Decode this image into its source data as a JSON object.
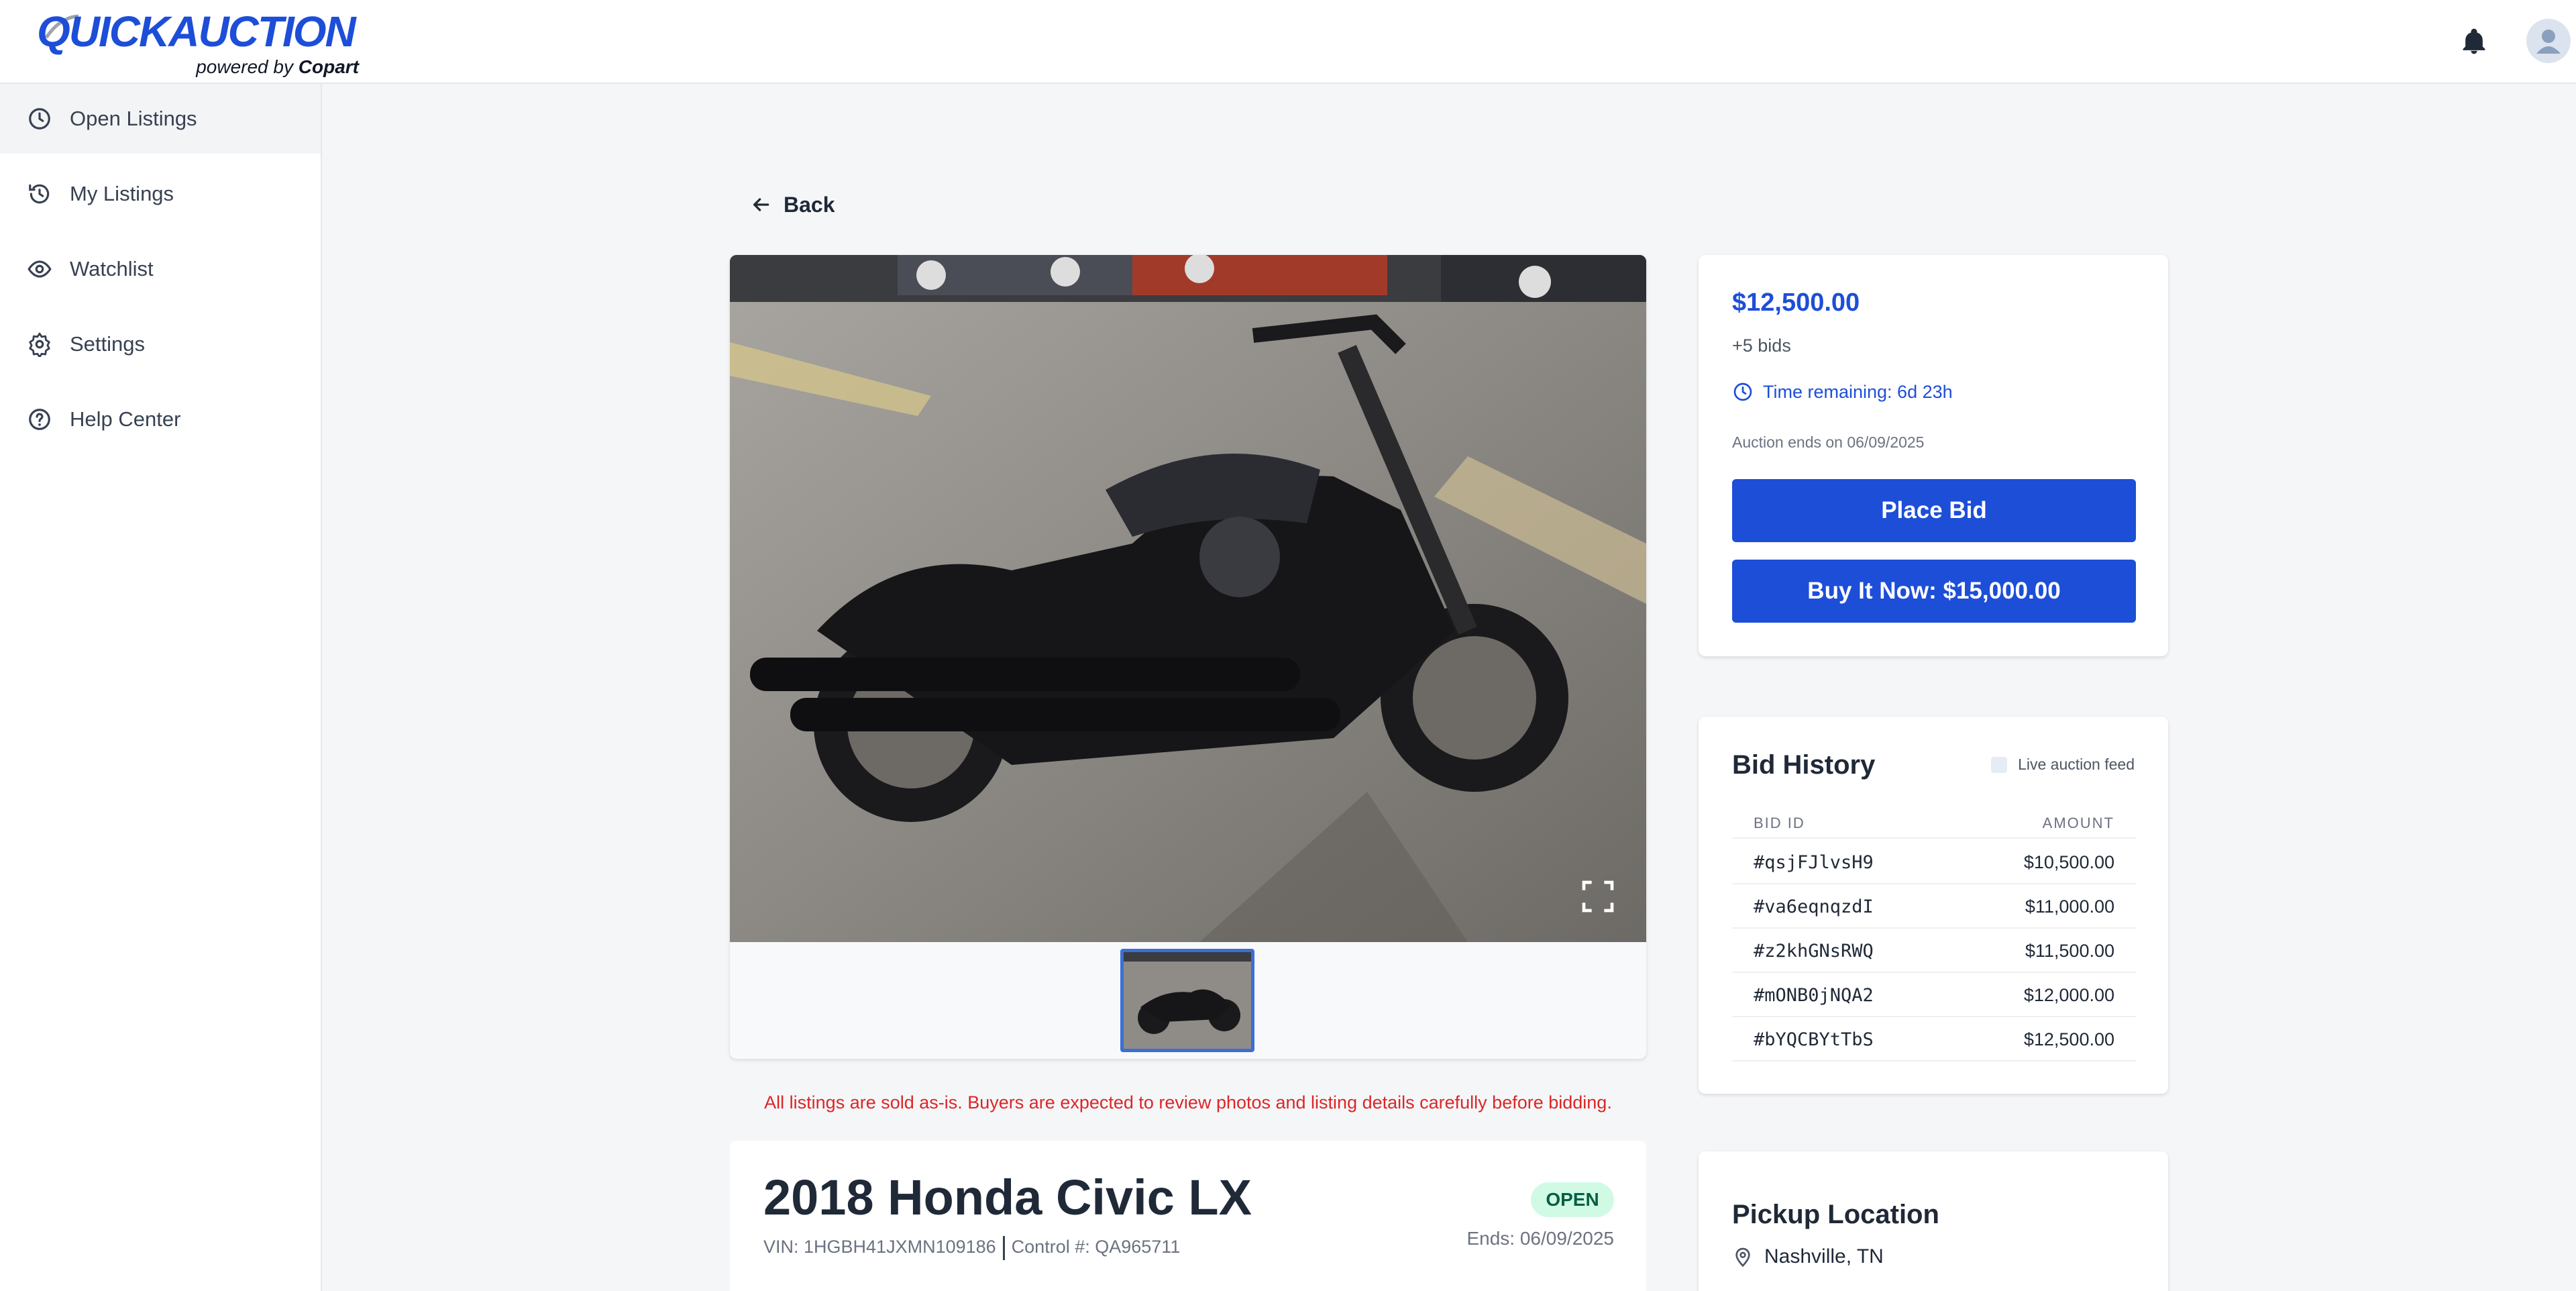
{
  "header": {
    "logo_main": "QUICKAUCTION",
    "logo_powered": "powered by",
    "logo_brand": "Copart"
  },
  "sidebar": {
    "items": [
      {
        "label": "Open Listings",
        "icon": "clock-icon"
      },
      {
        "label": "My Listings",
        "icon": "history-icon"
      },
      {
        "label": "Watchlist",
        "icon": "eye-icon"
      },
      {
        "label": "Settings",
        "icon": "gear-icon"
      },
      {
        "label": "Help Center",
        "icon": "help-icon"
      }
    ]
  },
  "main": {
    "back_label": "Back",
    "disclaimer": "All listings are sold as-is. Buyers are expected to review photos and listing details carefully before bidding.",
    "title": "2018 Honda Civic LX",
    "vin": "VIN: 1HGBH41JXMN109186",
    "control": "Control #: QA965711",
    "status": "OPEN",
    "ends": "Ends: 06/09/2025"
  },
  "bid_card": {
    "price": "$12,500.00",
    "bids": "+5 bids",
    "time_remaining": "Time remaining: 6d 23h",
    "auction_ends": "Auction ends on 06/09/2025",
    "place_bid": "Place Bid",
    "buy_now": "Buy It Now: $15,000.00"
  },
  "bid_history": {
    "title": "Bid History",
    "live_feed": "Live auction feed",
    "col_id": "BID ID",
    "col_amount": "AMOUNT",
    "rows": [
      {
        "id": "#qsjFJlvsH9",
        "amount": "$10,500.00"
      },
      {
        "id": "#va6eqnqzdI",
        "amount": "$11,000.00"
      },
      {
        "id": "#z2khGNsRWQ",
        "amount": "$11,500.00"
      },
      {
        "id": "#mONB0jNQA2",
        "amount": "$12,000.00"
      },
      {
        "id": "#bYQCBYtTbS",
        "amount": "$12,500.00"
      }
    ]
  },
  "pickup": {
    "title": "Pickup Location",
    "location": "Nashville, TN"
  },
  "colors": {
    "accent": "#1d4ed8",
    "status_bg": "#d1fae5",
    "warning": "#dc2626"
  }
}
